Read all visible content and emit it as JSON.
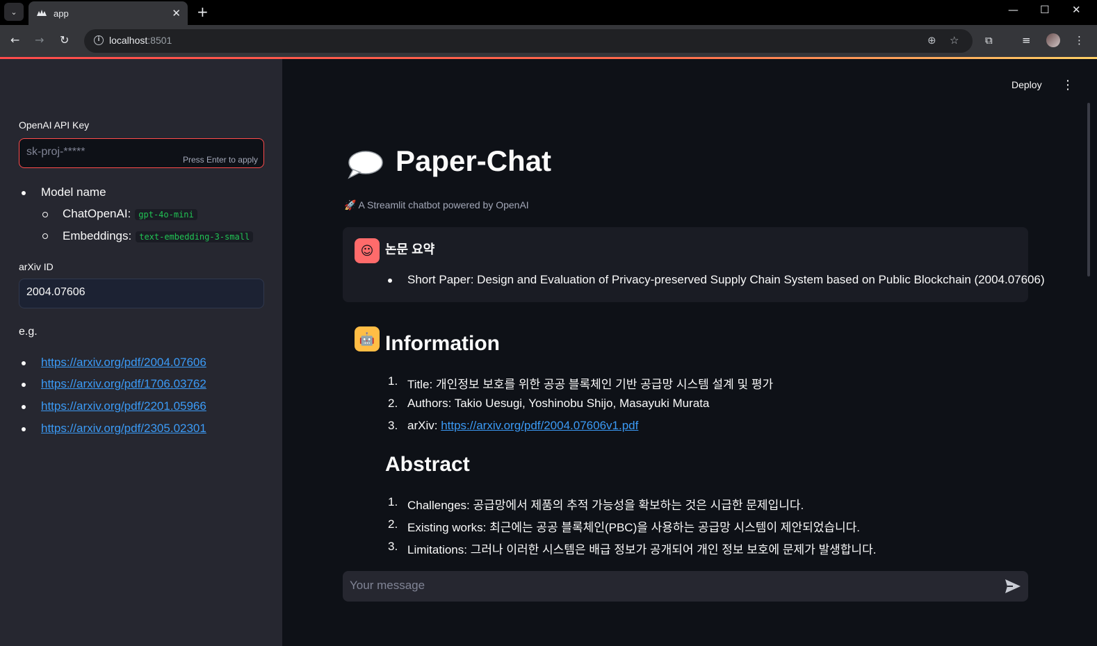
{
  "browser": {
    "tab_title": "app",
    "url_host": "localhost",
    "url_port": ":8501"
  },
  "sidebar": {
    "api_key_label": "OpenAI API Key",
    "api_key_placeholder": "sk-proj-*****",
    "api_key_hint": "Press Enter to apply",
    "model_name_label": "Model name",
    "chat_model_label": "ChatOpenAI:",
    "chat_model_value": "gpt-4o-mini",
    "embeddings_label": "Embeddings:",
    "embeddings_value": "text-embedding-3-small",
    "arxiv_label": "arXiv ID",
    "arxiv_value": "2004.07606",
    "examples_label": "e.g.",
    "examples": [
      "https://arxiv.org/pdf/2004.07606",
      "https://arxiv.org/pdf/1706.03762",
      "https://arxiv.org/pdf/2201.05966",
      "https://arxiv.org/pdf/2305.02301"
    ]
  },
  "header": {
    "deploy_label": "Deploy"
  },
  "main": {
    "title": "Paper-Chat",
    "caption": "🚀 A Streamlit chatbot powered by OpenAI",
    "user_message": {
      "heading": "논문 요약",
      "item": "Short Paper: Design and Evaluation of Privacy-preserved Supply Chain System based on Public Blockchain (2004.07606)"
    },
    "assistant_message": {
      "info_heading": "Information",
      "info_items": [
        {
          "label": "Title:",
          "value": "개인정보 보호를 위한 공공 블록체인 기반 공급망 시스템 설계 및 평가"
        },
        {
          "label": "Authors:",
          "value": "Takio Uesugi, Yoshinobu Shijo, Masayuki Murata"
        },
        {
          "label": "arXiv:",
          "value": "https://arxiv.org/pdf/2004.07606v1.pdf"
        }
      ],
      "abstract_heading": "Abstract",
      "abstract_items": [
        {
          "label": "Challenges:",
          "value": "공급망에서 제품의 추적 가능성을 확보하는 것은 시급한 문제입니다."
        },
        {
          "label": "Existing works:",
          "value": "최근에는 공공 블록체인(PBC)을 사용하는 공급망 시스템이 제안되었습니다."
        },
        {
          "label": "Limitations:",
          "value": "그러나 이러한 시스템은 배급 정보가 공개되어 개인 정보 보호에 문제가 발생합니다."
        }
      ]
    },
    "chat_input_placeholder": "Your message"
  },
  "colors": {
    "accent": "#ff4b4b",
    "link": "#3b9af5",
    "code_text": "#21c354",
    "user_avatar": "#ff6b6b",
    "assistant_avatar": "#ffbd45"
  }
}
